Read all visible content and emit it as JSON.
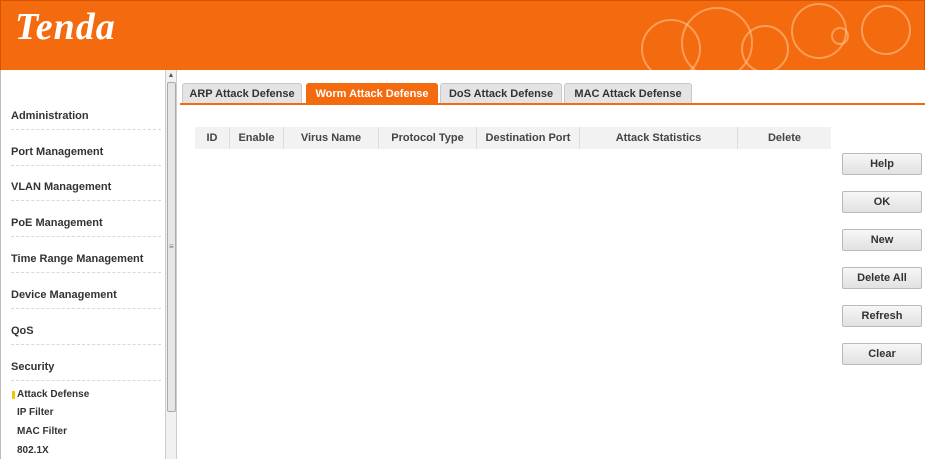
{
  "header": {
    "logo_text": "Tenda"
  },
  "sidebar": {
    "items": [
      {
        "label": "Administration"
      },
      {
        "label": "Port Management"
      },
      {
        "label": "VLAN Management"
      },
      {
        "label": "PoE Management"
      },
      {
        "label": "Time Range Management"
      },
      {
        "label": "Device Management"
      },
      {
        "label": "QoS"
      },
      {
        "label": "Security"
      }
    ],
    "sub_items": [
      {
        "label": "Attack Defense",
        "active": true
      },
      {
        "label": "IP Filter"
      },
      {
        "label": "MAC Filter"
      },
      {
        "label": "802.1X"
      }
    ]
  },
  "tabs": [
    {
      "label": "ARP Attack Defense"
    },
    {
      "label": "Worm Attack Defense",
      "active": true
    },
    {
      "label": "DoS Attack Defense"
    },
    {
      "label": "MAC Attack Defense"
    }
  ],
  "table": {
    "columns": [
      "ID",
      "Enable",
      "Virus Name",
      "Protocol Type",
      "Destination Port",
      "Attack Statistics",
      "Delete"
    ],
    "rows": []
  },
  "buttons": {
    "help": "Help",
    "ok": "OK",
    "new": "New",
    "delete_all": "Delete All",
    "refresh": "Refresh",
    "clear": "Clear"
  },
  "colors": {
    "brand": "#f46a0e",
    "active_marker": "#f5c400"
  }
}
